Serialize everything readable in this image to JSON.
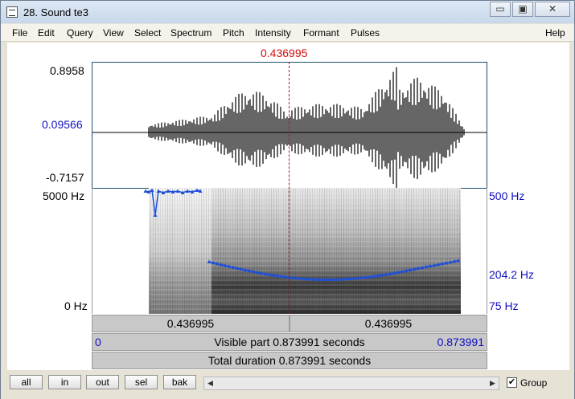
{
  "window": {
    "title": "28. Sound te3"
  },
  "window_controls": {
    "minimize": "▭",
    "maximize": "▣",
    "close": "✕"
  },
  "menu": {
    "items": [
      "File",
      "Edit",
      "Query",
      "View",
      "Select",
      "Spectrum",
      "Pitch",
      "Intensity",
      "Formant",
      "Pulses"
    ],
    "help": "Help"
  },
  "cursor": {
    "time_label": "0.436995"
  },
  "waveform": {
    "max_label": "0.8958",
    "cursor_value_label": "0.09566",
    "min_label": "-0.7157"
  },
  "spectrogram": {
    "freq_top_label": "5000 Hz",
    "freq_bottom_label": "0 Hz"
  },
  "pitch": {
    "top_label": "500 Hz",
    "cursor_label": "204.2 Hz",
    "bottom_label": "75 Hz"
  },
  "time_bars": {
    "left_segment": "0.436995",
    "right_segment": "0.436995",
    "visible_start": "0",
    "visible_part": "Visible part 0.873991 seconds",
    "visible_end": "0.873991",
    "total_duration": "Total duration 0.873991 seconds"
  },
  "toolbar": {
    "buttons": [
      "all",
      "in",
      "out",
      "sel",
      "bak"
    ],
    "group_label": "Group",
    "group_checked": "✔"
  },
  "colors": {
    "cursor": "#d01010",
    "pitch": "#1f4fd8",
    "axis_blue": "#1010c0"
  }
}
